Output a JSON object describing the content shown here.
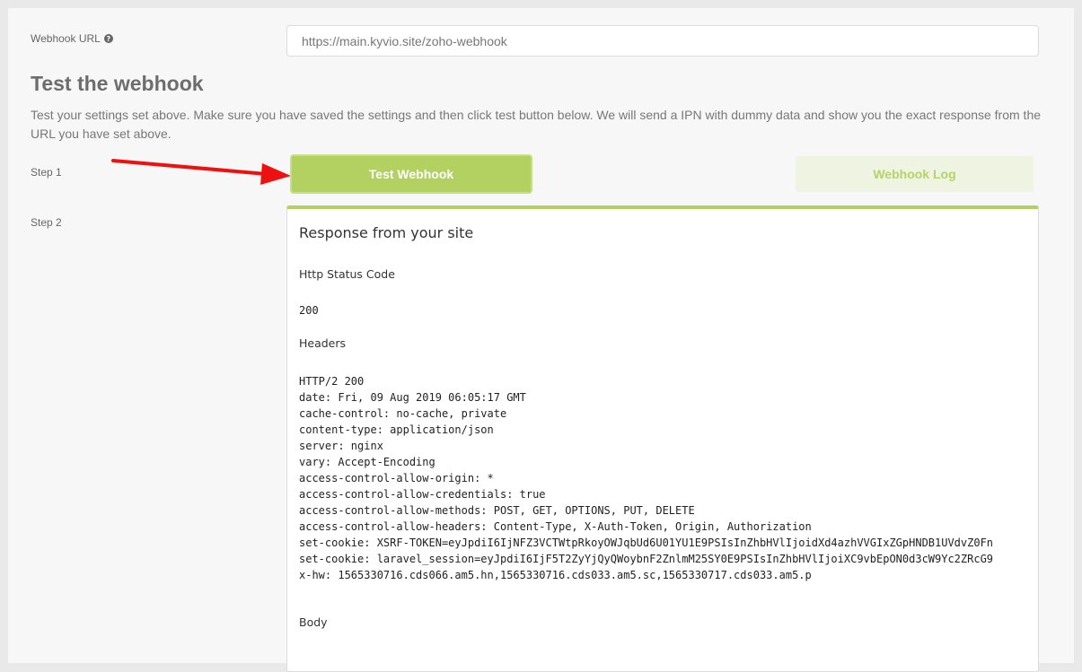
{
  "webhook_url": {
    "label": "Webhook URL",
    "help_icon": "question-circle-icon",
    "value": "https://main.kyvio.site/zoho-webhook"
  },
  "test_section": {
    "title": "Test the webhook",
    "description": "Test your settings set above. Make sure you have saved the settings and then click test button below. We will send a IPN with dummy data and show you the exact response from the URL you have set above.",
    "step1_label": "Step 1",
    "step2_label": "Step 2",
    "test_button_label": "Test Webhook",
    "log_button_label": "Webhook Log"
  },
  "response": {
    "title": "Response from your site",
    "status_heading": "Http Status Code",
    "status_code": "200",
    "headers_heading": "Headers",
    "headers": [
      "HTTP/2 200",
      "date: Fri, 09 Aug 2019 06:05:17 GMT",
      "cache-control: no-cache, private",
      "content-type: application/json",
      "server: nginx",
      "vary: Accept-Encoding",
      "access-control-allow-origin: *",
      "access-control-allow-credentials: true",
      "access-control-allow-methods: POST, GET, OPTIONS, PUT, DELETE",
      "access-control-allow-headers: Content-Type, X-Auth-Token, Origin, Authorization",
      "set-cookie: XSRF-TOKEN=eyJpdiI6IjNFZ3VCTWtpRkoyOWJqbUd6U01YU1E9PSIsInZhbHVlIjoidXd4azhVVGIxZGpHNDB1UVdvZ0Fn",
      "set-cookie: laravel_session=eyJpdiI6IjF5T2ZyYjQyQWoybnF2ZnlmM25SY0E9PSIsInZhbHVlIjoiXC9vbEpON0d3cW9Yc2ZRcG9",
      "x-hw: 1565330716.cds066.am5.hn,1565330716.cds033.am5.sc,1565330717.cds033.am5.p"
    ],
    "body_heading": "Body"
  },
  "colors": {
    "accent": "#b3d160",
    "arrow": "#ee1111"
  }
}
